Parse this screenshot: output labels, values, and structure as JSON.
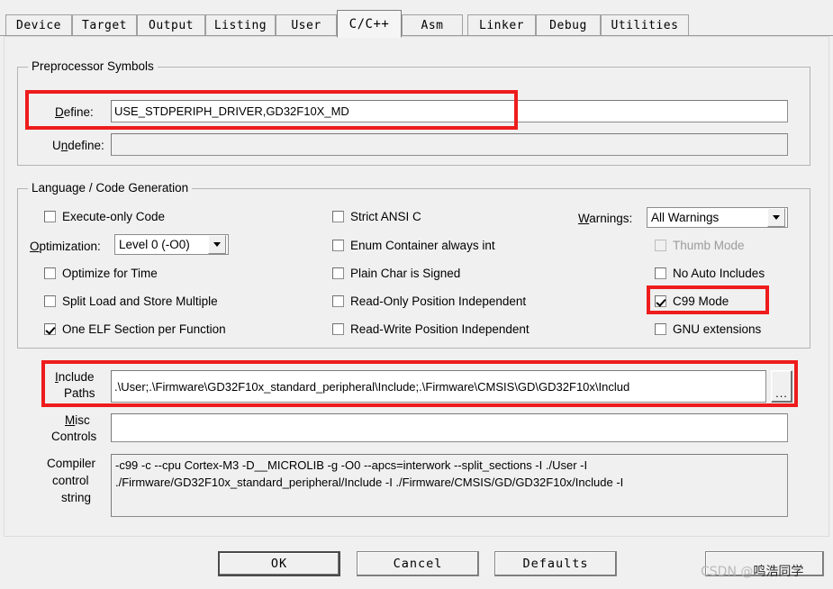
{
  "dialog": {
    "tabs": [
      {
        "label": "Device",
        "active": false
      },
      {
        "label": "Target",
        "active": false
      },
      {
        "label": "Output",
        "active": false
      },
      {
        "label": "Listing",
        "active": false
      },
      {
        "label": "User",
        "active": false
      },
      {
        "label": "C/C++",
        "active": true
      },
      {
        "label": "Asm",
        "active": false
      },
      {
        "label": "Linker",
        "active": false
      },
      {
        "label": "Debug",
        "active": false
      },
      {
        "label": "Utilities",
        "active": false
      }
    ]
  },
  "preprocessor": {
    "group_title": "Preprocessor Symbols",
    "define_label": "Define:",
    "define_value": "USE_STDPERIPH_DRIVER,GD32F10X_MD",
    "undefine_label": "Undefine:",
    "undefine_value": ""
  },
  "language": {
    "group_title": "Language / Code Generation",
    "col1": [
      {
        "label": "Execute-only Code",
        "checked": false,
        "disabled": false
      },
      {
        "label": "Optimize for Time",
        "checked": false,
        "disabled": false
      },
      {
        "label": "Split Load and Store Multiple",
        "checked": false,
        "disabled": false
      },
      {
        "label": "One ELF Section per Function",
        "checked": true,
        "disabled": false
      }
    ],
    "optimization_label": "Optimization:",
    "optimization_value": "Level 0 (-O0)",
    "col2": [
      {
        "label": "Strict ANSI C",
        "checked": false,
        "disabled": false
      },
      {
        "label": "Enum Container always int",
        "checked": false,
        "disabled": false
      },
      {
        "label": "Plain Char is Signed",
        "checked": false,
        "disabled": false
      },
      {
        "label": "Read-Only Position Independent",
        "checked": false,
        "disabled": false
      },
      {
        "label": "Read-Write Position Independent",
        "checked": false,
        "disabled": false
      }
    ],
    "warnings_label": "Warnings:",
    "warnings_value": "All Warnings",
    "col3": [
      {
        "label": "Thumb Mode",
        "checked": false,
        "disabled": true
      },
      {
        "label": "No Auto Includes",
        "checked": false,
        "disabled": false
      },
      {
        "label": "C99 Mode",
        "checked": true,
        "disabled": false
      },
      {
        "label": "GNU extensions",
        "checked": false,
        "disabled": false
      }
    ]
  },
  "paths": {
    "include_label_line1": "Include",
    "include_label_line2": "Paths",
    "include_value": ".\\User;.\\Firmware\\GD32F10x_standard_peripheral\\Include;.\\Firmware\\CMSIS\\GD\\GD32F10x\\Includ",
    "browse_label": "...",
    "misc_label_line1": "Misc",
    "misc_label_line2": "Controls",
    "misc_value": "",
    "compiler_label_line1": "Compiler",
    "compiler_label_line2": "control",
    "compiler_label_line3": "string",
    "compiler_value": "-c99 -c --cpu Cortex-M3 -D__MICROLIB -g -O0 --apcs=interwork --split_sections -I ./User -I ./Firmware/GD32F10x_standard_peripheral/Include -I ./Firmware/CMSIS/GD/GD32F10x/Include -I"
  },
  "buttons": {
    "ok": "OK",
    "cancel": "Cancel",
    "defaults": "Defaults",
    "help": ""
  },
  "watermark": {
    "prefix": "CSDN @",
    "name": "鸣浩同学"
  },
  "colors": {
    "highlight": "#ee1c1c",
    "dialog_bg": "#f0f0f0",
    "field_bg": "#ffffff"
  }
}
